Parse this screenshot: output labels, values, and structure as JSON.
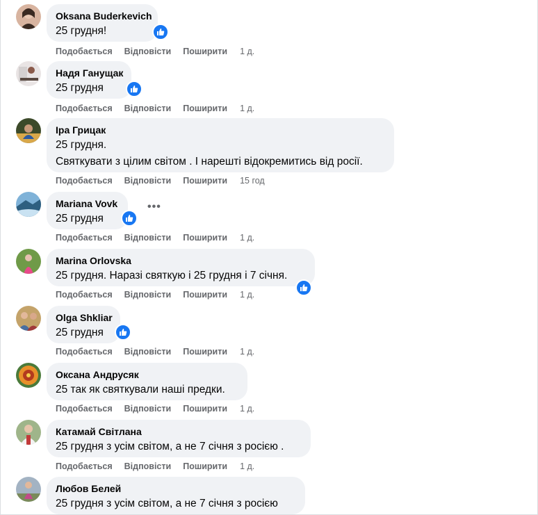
{
  "actions": {
    "like_label": "Подобається",
    "reply_label": "Відповісти",
    "share_label": "Поширити"
  },
  "comments": [
    {
      "author": "Oksana Buderkevich",
      "lines": [
        "25 грудня!"
      ],
      "time": "1 д.",
      "reaction": "like-icon",
      "avatar_colors": [
        "#d8b4a0",
        "#3a2a22"
      ]
    },
    {
      "author": "Надя Ганущак",
      "lines": [
        "25 грудня"
      ],
      "time": "1 д.",
      "reaction": "like-icon",
      "avatar_colors": [
        "#e9e4e4",
        "#8a5a4a"
      ]
    },
    {
      "author": "Іра Грицак",
      "lines": [
        "25 грудня.",
        "Святкувати з цілим світом . І нарешті відокремитись від росії."
      ],
      "time": "15 год",
      "reaction": null,
      "avatar_colors": [
        "#3c4a2a",
        "#d9a84a"
      ]
    },
    {
      "author": "Mariana Vovk",
      "lines": [
        "25 грудня"
      ],
      "time": "1 д.",
      "reaction": "like-icon",
      "avatar_colors": [
        "#7fb2d8",
        "#2e5f80"
      ]
    },
    {
      "author": "Marina Orlovska",
      "lines": [
        "25 грудня. Наразі святкую і 25 грудня і 7 січня."
      ],
      "time": "1 д.",
      "reaction": "like-icon",
      "avatar_colors": [
        "#6f9a48",
        "#e6c0b0"
      ]
    },
    {
      "author": "Olga Shkliar",
      "lines": [
        "25 грудня"
      ],
      "time": "1 д.",
      "reaction": "like-icon",
      "avatar_colors": [
        "#c4a36a",
        "#4a6fa0"
      ]
    },
    {
      "author": "Оксана Андрусяк",
      "lines": [
        "25 так як святкували наші предки."
      ],
      "time": "1 д.",
      "reaction": null,
      "avatar_colors": [
        "#e8902a",
        "#b33a1e"
      ]
    },
    {
      "author": "Катамай Світлана",
      "lines": [
        "25 грудня з усім світом, а не 7 січня з росією ."
      ],
      "time": "1 д.",
      "reaction": null,
      "avatar_colors": [
        "#9fb58a",
        "#c23a3a"
      ]
    },
    {
      "author": "Любов Белей",
      "lines": [
        "25 грудня з усім світом, а не 7 січня з росією"
      ],
      "time": "",
      "reaction": null,
      "avatar_colors": [
        "#a3b3c3",
        "#c24a8a"
      ]
    }
  ],
  "more_options": "•••"
}
